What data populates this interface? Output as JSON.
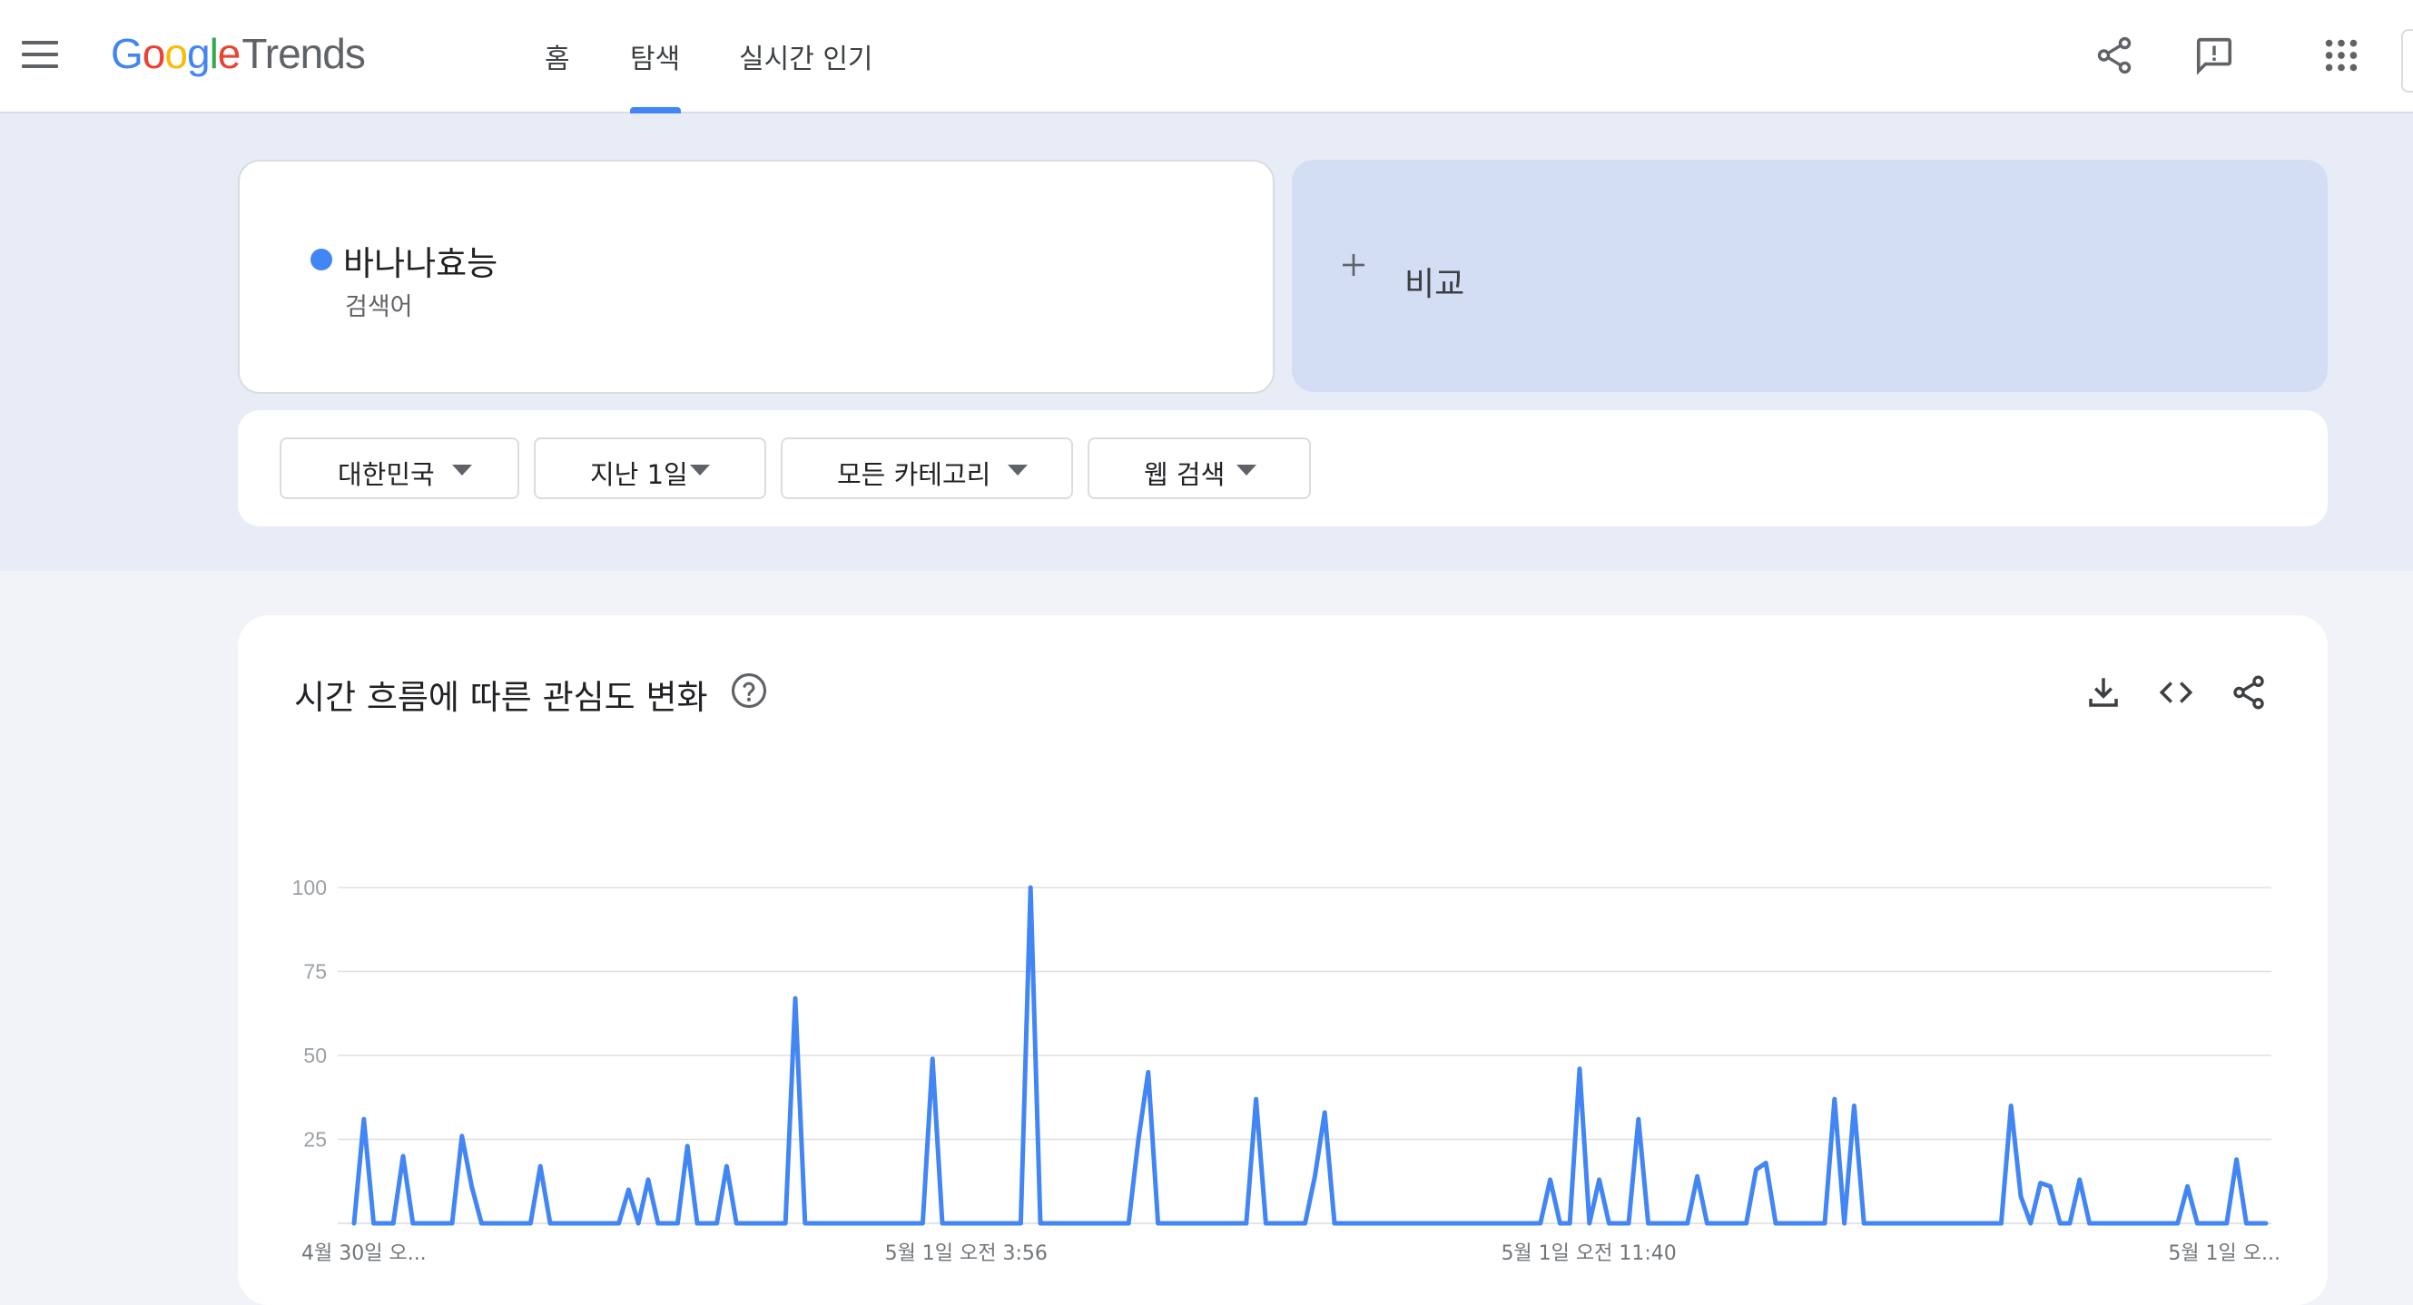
{
  "header": {
    "logo_google": "Google",
    "logo_trends": "Trends",
    "tabs": [
      {
        "label": "홈",
        "active": false
      },
      {
        "label": "탐색",
        "active": true
      },
      {
        "label": "실시간 인기",
        "active": false
      }
    ],
    "icons": [
      "menu-icon",
      "share-icon",
      "feedback-icon",
      "apps-icon"
    ]
  },
  "search": {
    "term": "바나나효능",
    "term_type": "검색어",
    "term_color": "#4285f4",
    "compare_label": "비교"
  },
  "filters": [
    {
      "label": "대한민국"
    },
    {
      "label": "지난 1일"
    },
    {
      "label": "모든 카테고리"
    },
    {
      "label": "웹 검색"
    }
  ],
  "interest_card": {
    "title": "시간 흐름에 따른 관심도 변화",
    "icons": [
      "help-icon",
      "download-icon",
      "embed-code-icon",
      "share-icon"
    ]
  },
  "chart_data": {
    "type": "line",
    "ylim": [
      0,
      100
    ],
    "y_ticks": [
      25,
      50,
      75,
      100
    ],
    "x_tick_labels": [
      "4월 30일 오...",
      "5월 1일 오전 3:56",
      "5월 1일 오전 11:40",
      "5월 1일 오..."
    ],
    "grid": true,
    "series": [
      {
        "color": "#4285f4",
        "values": [
          0,
          31,
          0,
          0,
          0,
          20,
          0,
          0,
          0,
          0,
          0,
          26,
          11,
          0,
          0,
          0,
          0,
          0,
          0,
          17,
          0,
          0,
          0,
          0,
          0,
          0,
          0,
          0,
          10,
          0,
          13,
          0,
          0,
          0,
          23,
          0,
          0,
          0,
          17,
          0,
          0,
          0,
          0,
          0,
          0,
          67,
          0,
          0,
          0,
          0,
          0,
          0,
          0,
          0,
          0,
          0,
          0,
          0,
          0,
          49,
          0,
          0,
          0,
          0,
          0,
          0,
          0,
          0,
          0,
          100,
          0,
          0,
          0,
          0,
          0,
          0,
          0,
          0,
          0,
          0,
          25,
          45,
          0,
          0,
          0,
          0,
          0,
          0,
          0,
          0,
          0,
          0,
          37,
          0,
          0,
          0,
          0,
          0,
          14,
          33,
          0,
          0,
          0,
          0,
          0,
          0,
          0,
          0,
          0,
          0,
          0,
          0,
          0,
          0,
          0,
          0,
          0,
          0,
          0,
          0,
          0,
          0,
          13,
          0,
          0,
          46,
          0,
          13,
          0,
          0,
          0,
          31,
          0,
          0,
          0,
          0,
          0,
          14,
          0,
          0,
          0,
          0,
          0,
          16,
          18,
          0,
          0,
          0,
          0,
          0,
          0,
          37,
          0,
          35,
          0,
          0,
          0,
          0,
          0,
          0,
          0,
          0,
          0,
          0,
          0,
          0,
          0,
          0,
          0,
          35,
          8,
          0,
          12,
          11,
          0,
          0,
          13,
          0,
          0,
          0,
          0,
          0,
          0,
          0,
          0,
          0,
          0,
          11,
          0,
          0,
          0,
          0,
          19,
          0,
          0,
          0
        ]
      }
    ]
  }
}
